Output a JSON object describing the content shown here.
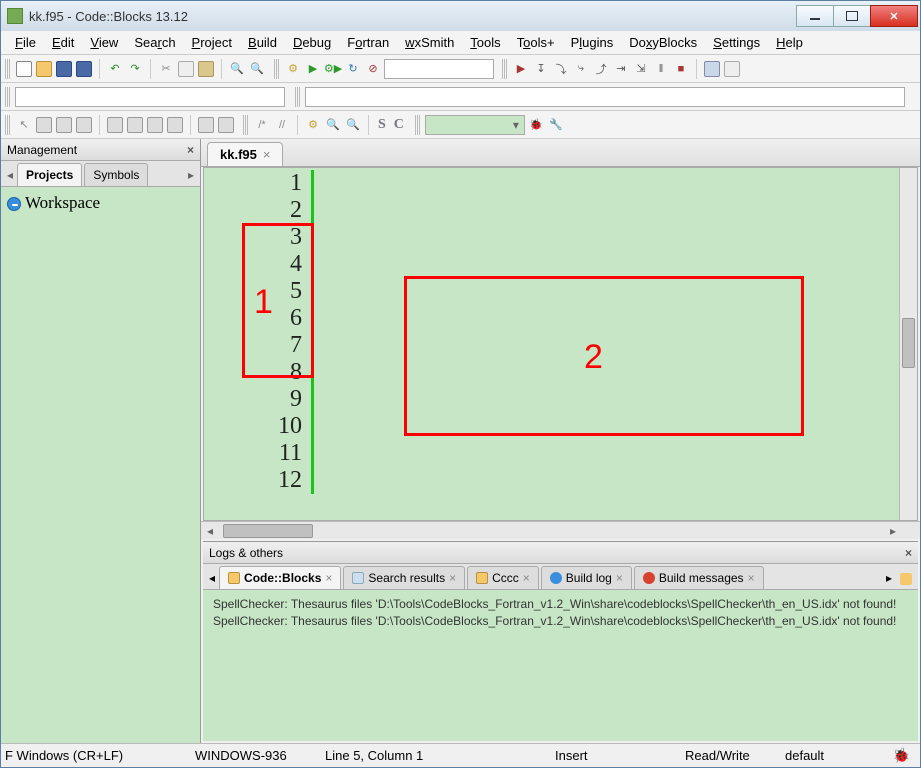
{
  "window": {
    "title": "kk.f95 - Code::Blocks 13.12"
  },
  "menu": [
    "File",
    "Edit",
    "View",
    "Search",
    "Project",
    "Build",
    "Debug",
    "Fortran",
    "wxSmith",
    "Tools",
    "Tools+",
    "Plugins",
    "DoxyBlocks",
    "Settings",
    "Help"
  ],
  "management": {
    "title": "Management",
    "tabs": [
      "Projects",
      "Symbols"
    ],
    "workspace": "Workspace"
  },
  "editor": {
    "tab": "kk.f95",
    "lines": [
      "1",
      "2",
      "3",
      "4",
      "5",
      "6",
      "7",
      "8",
      "9",
      "10",
      "11",
      "12"
    ]
  },
  "annotations": {
    "box1": "1",
    "box2": "2"
  },
  "logs": {
    "title": "Logs & others",
    "tabs": [
      "Code::Blocks",
      "Search results",
      "Cccc",
      "Build log",
      "Build messages"
    ],
    "lines": [
      "SpellChecker: Thesaurus files 'D:\\Tools\\CodeBlocks_Fortran_v1.2_Win\\share\\codeblocks\\SpellChecker\\th_en_US.idx' not found!",
      "SpellChecker: Thesaurus files 'D:\\Tools\\CodeBlocks_Fortran_v1.2_Win\\share\\codeblocks\\SpellChecker\\th_en_US.idx' not found!"
    ]
  },
  "status": {
    "eol": "F Windows (CR+LF)",
    "encoding": "WINDOWS-936",
    "pos": "Line 5, Column 1",
    "mode": "Insert",
    "rw": "Read/Write",
    "profile": "default"
  },
  "toolbar3": {
    "s": "S",
    "c": "C"
  }
}
